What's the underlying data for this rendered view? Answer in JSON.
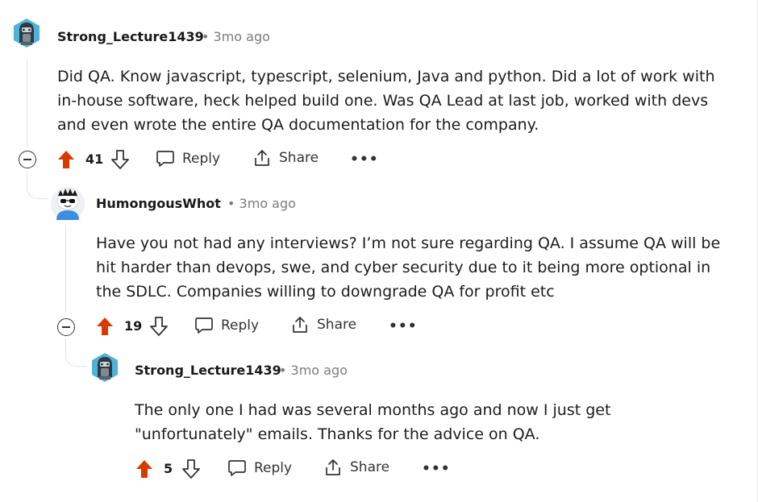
{
  "colors": {
    "upvote": "#d93a00",
    "text": "#1c1c1c",
    "meta": "#7c7c7c",
    "thread_line": "#dfe3e6"
  },
  "comments": [
    {
      "username": "Strong_Lecture1439",
      "meta": "• 3mo ago",
      "avatar": "robot-hood-avatar",
      "body_lines": [
        "Did QA. Know javascript, typescript, selenium, Java and python. Did a lot of work with",
        "in-house software, heck helped build one. Was QA Lead at last job, worked with devs",
        "and even wrote the entire QA documentation for the company."
      ],
      "votes": "41",
      "reply_label": "Reply",
      "share_label": "Share",
      "more_label": "•••"
    },
    {
      "username": "HumongousWhot",
      "meta": "• 3mo ago",
      "avatar": "snoo-sunglasses-avatar",
      "body_lines": [
        "Have you not had any interviews? I’m not sure regarding QA. I assume QA will be",
        "hit harder than devops, swe, and cyber security due to it being more optional in",
        "the SDLC. Companies willing to downgrade QA for profit etc"
      ],
      "votes": "19",
      "reply_label": "Reply",
      "share_label": "Share",
      "more_label": "•••"
    },
    {
      "username": "Strong_Lecture1439",
      "meta": "• 3mo ago",
      "avatar": "robot-hood-avatar",
      "body_lines": [
        "The only one I had was several months ago and now I just get",
        "\"unfortunately\" emails. Thanks for the advice on QA."
      ],
      "votes": "5",
      "reply_label": "Reply",
      "share_label": "Share",
      "more_label": "•••"
    }
  ]
}
